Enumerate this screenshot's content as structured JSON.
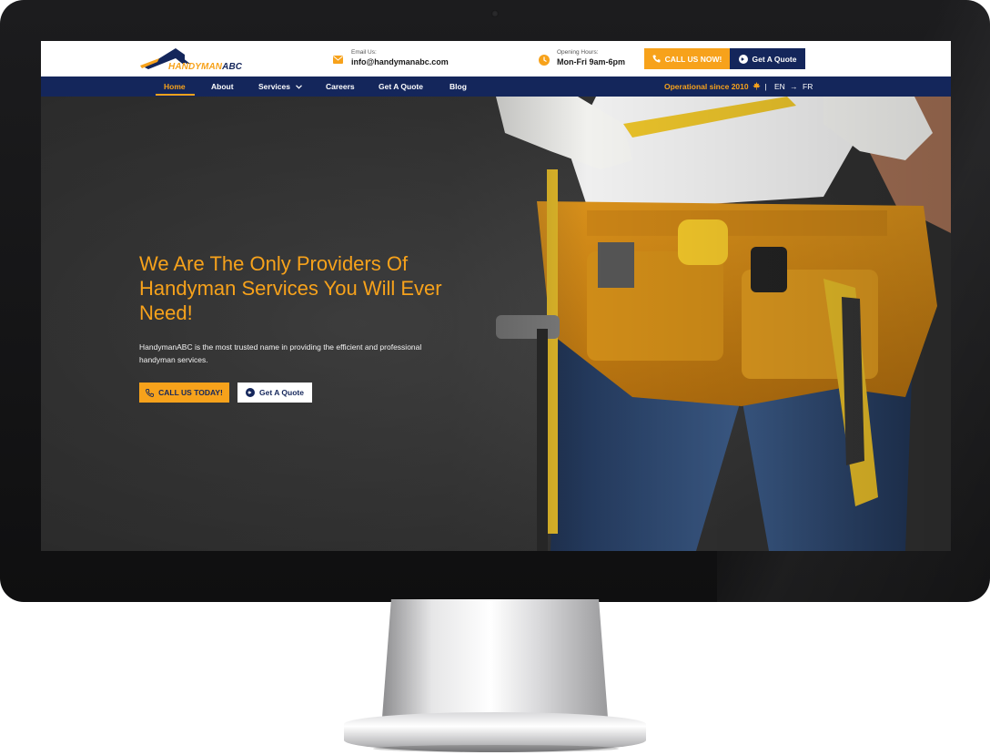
{
  "header": {
    "logo": {
      "text_main": "HANDYMAN",
      "text_accent": "ABC"
    },
    "email": {
      "label": "Email Us:",
      "value": "info@handymanabc.com",
      "icon": "envelope-icon"
    },
    "hours": {
      "label": "Opening Hours:",
      "value": "Mon-Fri 9am-6pm",
      "icon": "clock-icon"
    },
    "call_button": "CALL US NOW!",
    "quote_button": "Get A Quote"
  },
  "nav": {
    "items": [
      "Home",
      "About",
      "Services",
      "Careers",
      "Get A Quote",
      "Blog"
    ],
    "active": "Home",
    "operational": "Operational since 2010",
    "separator": "|",
    "lang_current": "EN",
    "lang_other": "FR"
  },
  "hero": {
    "title": "We Are The Only Providers Of Handyman Services You Will Ever Need!",
    "description": "HandymanABC is the most trusted name in providing the efficient and professional handyman services.",
    "call_button": "CALL US TODAY!",
    "quote_button": "Get A Quote"
  },
  "colors": {
    "accent": "#f7a21b",
    "navy": "#14265b"
  }
}
